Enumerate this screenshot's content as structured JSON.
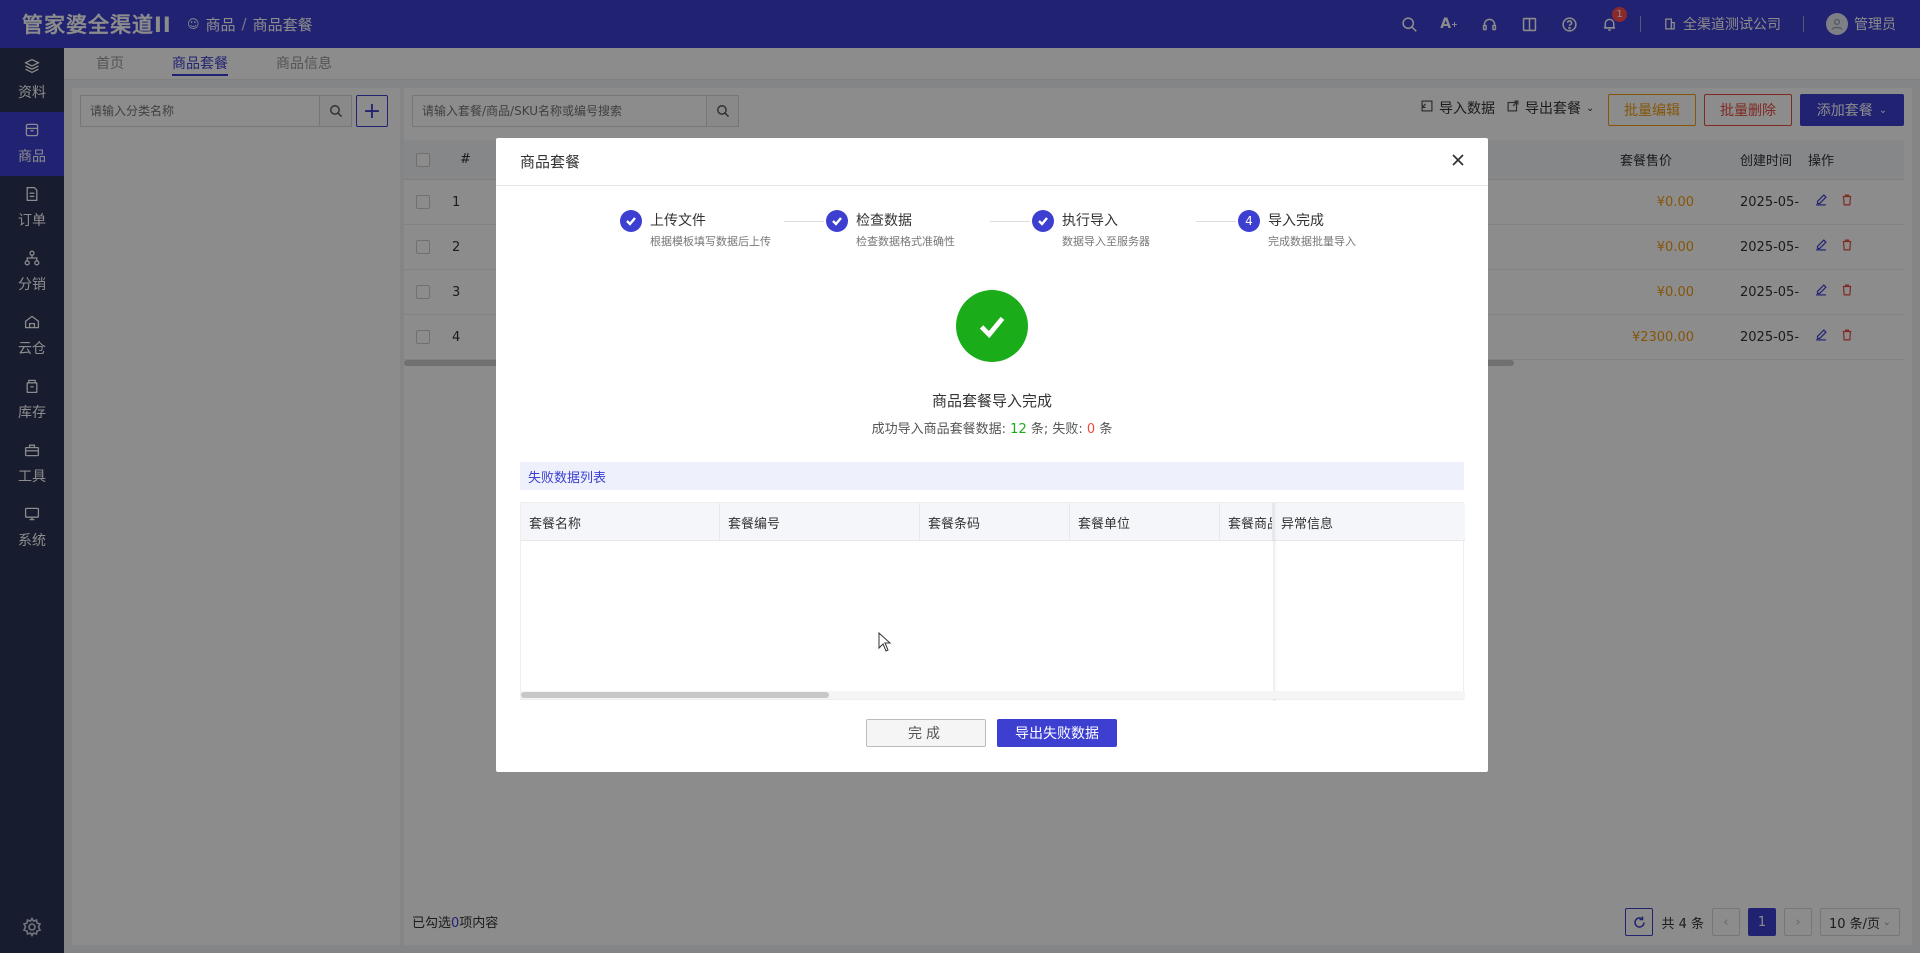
{
  "app": {
    "logo": "管家婆全渠道II"
  },
  "breadcrumb": {
    "parent": "商品",
    "separator": "/",
    "current": "商品套餐"
  },
  "topbar": {
    "notification_count": "1",
    "company": "全渠道测试公司",
    "user": "管理员"
  },
  "sidebar": {
    "items": [
      {
        "label": "资料",
        "icon": "layers-icon"
      },
      {
        "label": "商品",
        "icon": "box-icon"
      },
      {
        "label": "订单",
        "icon": "document-icon"
      },
      {
        "label": "分销",
        "icon": "network-icon"
      },
      {
        "label": "云仓",
        "icon": "warehouse-icon"
      },
      {
        "label": "库存",
        "icon": "stack-icon"
      },
      {
        "label": "工具",
        "icon": "toolbox-icon"
      },
      {
        "label": "系统",
        "icon": "monitor-icon"
      }
    ]
  },
  "tabs": [
    {
      "label": "首页"
    },
    {
      "label": "商品套餐"
    },
    {
      "label": "商品信息"
    }
  ],
  "category_search": {
    "placeholder": "请输入分类名称"
  },
  "package_search": {
    "placeholder": "请输入套餐/商品/SKU名称或编号搜索"
  },
  "toolbar": {
    "import_label": "导入数据",
    "export_label": "导出套餐",
    "batch_edit_label": "批量编辑",
    "batch_delete_label": "批量删除",
    "add_label": "添加套餐"
  },
  "table": {
    "headers": {
      "index": "#",
      "price": "套餐售价",
      "created": "创建时间",
      "ops": "操作"
    },
    "rows": [
      {
        "index": "1",
        "price": "¥0.00",
        "created": "2025-05-"
      },
      {
        "index": "2",
        "price": "¥0.00",
        "created": "2025-05-"
      },
      {
        "index": "3",
        "price": "¥0.00",
        "created": "2025-05-"
      },
      {
        "index": "4",
        "price": "¥2300.00",
        "created": "2025-05-"
      }
    ]
  },
  "footer": {
    "selected_prefix": "已勾选",
    "selected_count": "0",
    "selected_suffix": "项内容",
    "total": "共 4 条",
    "current_page": "1",
    "page_size": "10 条/页"
  },
  "modal": {
    "title": "商品套餐",
    "steps": [
      {
        "title": "上传文件",
        "desc": "根据模板填写数据后上传",
        "status": "done"
      },
      {
        "title": "检查数据",
        "desc": "检查数据格式准确性",
        "status": "done"
      },
      {
        "title": "执行导入",
        "desc": "数据导入至服务器",
        "status": "done"
      },
      {
        "title": "导入完成",
        "desc": "完成数据批量导入",
        "status": "current",
        "number": "4"
      }
    ],
    "result_title": "商品套餐导入完成",
    "result_prefix": "成功导入商品套餐数据:",
    "success_count": "12",
    "count_unit": "条;",
    "fail_label": "失败:",
    "fail_count": "0",
    "fail_unit": "条",
    "fail_list_title": "失败数据列表",
    "fail_columns": [
      "套餐名称",
      "套餐编号",
      "套餐条码",
      "套餐单位",
      "套餐商品",
      "异常信息"
    ],
    "done_button": "完成",
    "export_button": "导出失败数据"
  },
  "colors": {
    "primary": "#3c3fd0",
    "success": "#1aad19",
    "danger": "#e74c3c",
    "warning": "#f39c12"
  }
}
